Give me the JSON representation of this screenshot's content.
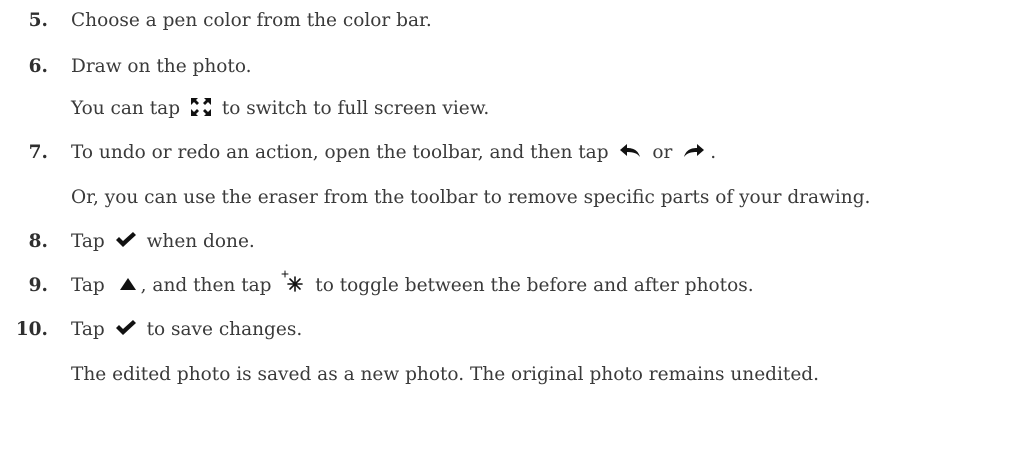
{
  "steps": [
    {
      "number": "5.",
      "text": "Choose a pen color from the color bar."
    },
    {
      "number": "6.",
      "text": "Draw on the photo."
    },
    {
      "number": "7.",
      "before": "To undo or redo an action, open the toolbar, and then tap",
      "middle": "or",
      "after": "."
    },
    {
      "number": "8.",
      "before": "Tap",
      "after": "when done."
    },
    {
      "number": "9.",
      "before": "Tap",
      "middle": ", and then tap",
      "after": "to toggle between the before and after photos."
    },
    {
      "number": "10.",
      "before": "Tap",
      "after": "to save changes."
    }
  ],
  "notes": {
    "fullscreen": {
      "before": "You can tap",
      "after": "to switch to full screen view."
    },
    "eraser": "Or, you can use the eraser from the toolbar to remove specific parts of your drawing.",
    "saved": "The edited photo is saved as a new photo. The original photo remains unedited."
  },
  "icons": {
    "fullscreen": "fullscreen-icon",
    "undo": "undo-icon",
    "redo": "redo-icon",
    "check": "check-icon",
    "up_arrow": "up-arrow-icon",
    "sparkle": "sparkle-icon"
  },
  "colors": {
    "text": "#3a3a3a",
    "icon": "#111111"
  }
}
